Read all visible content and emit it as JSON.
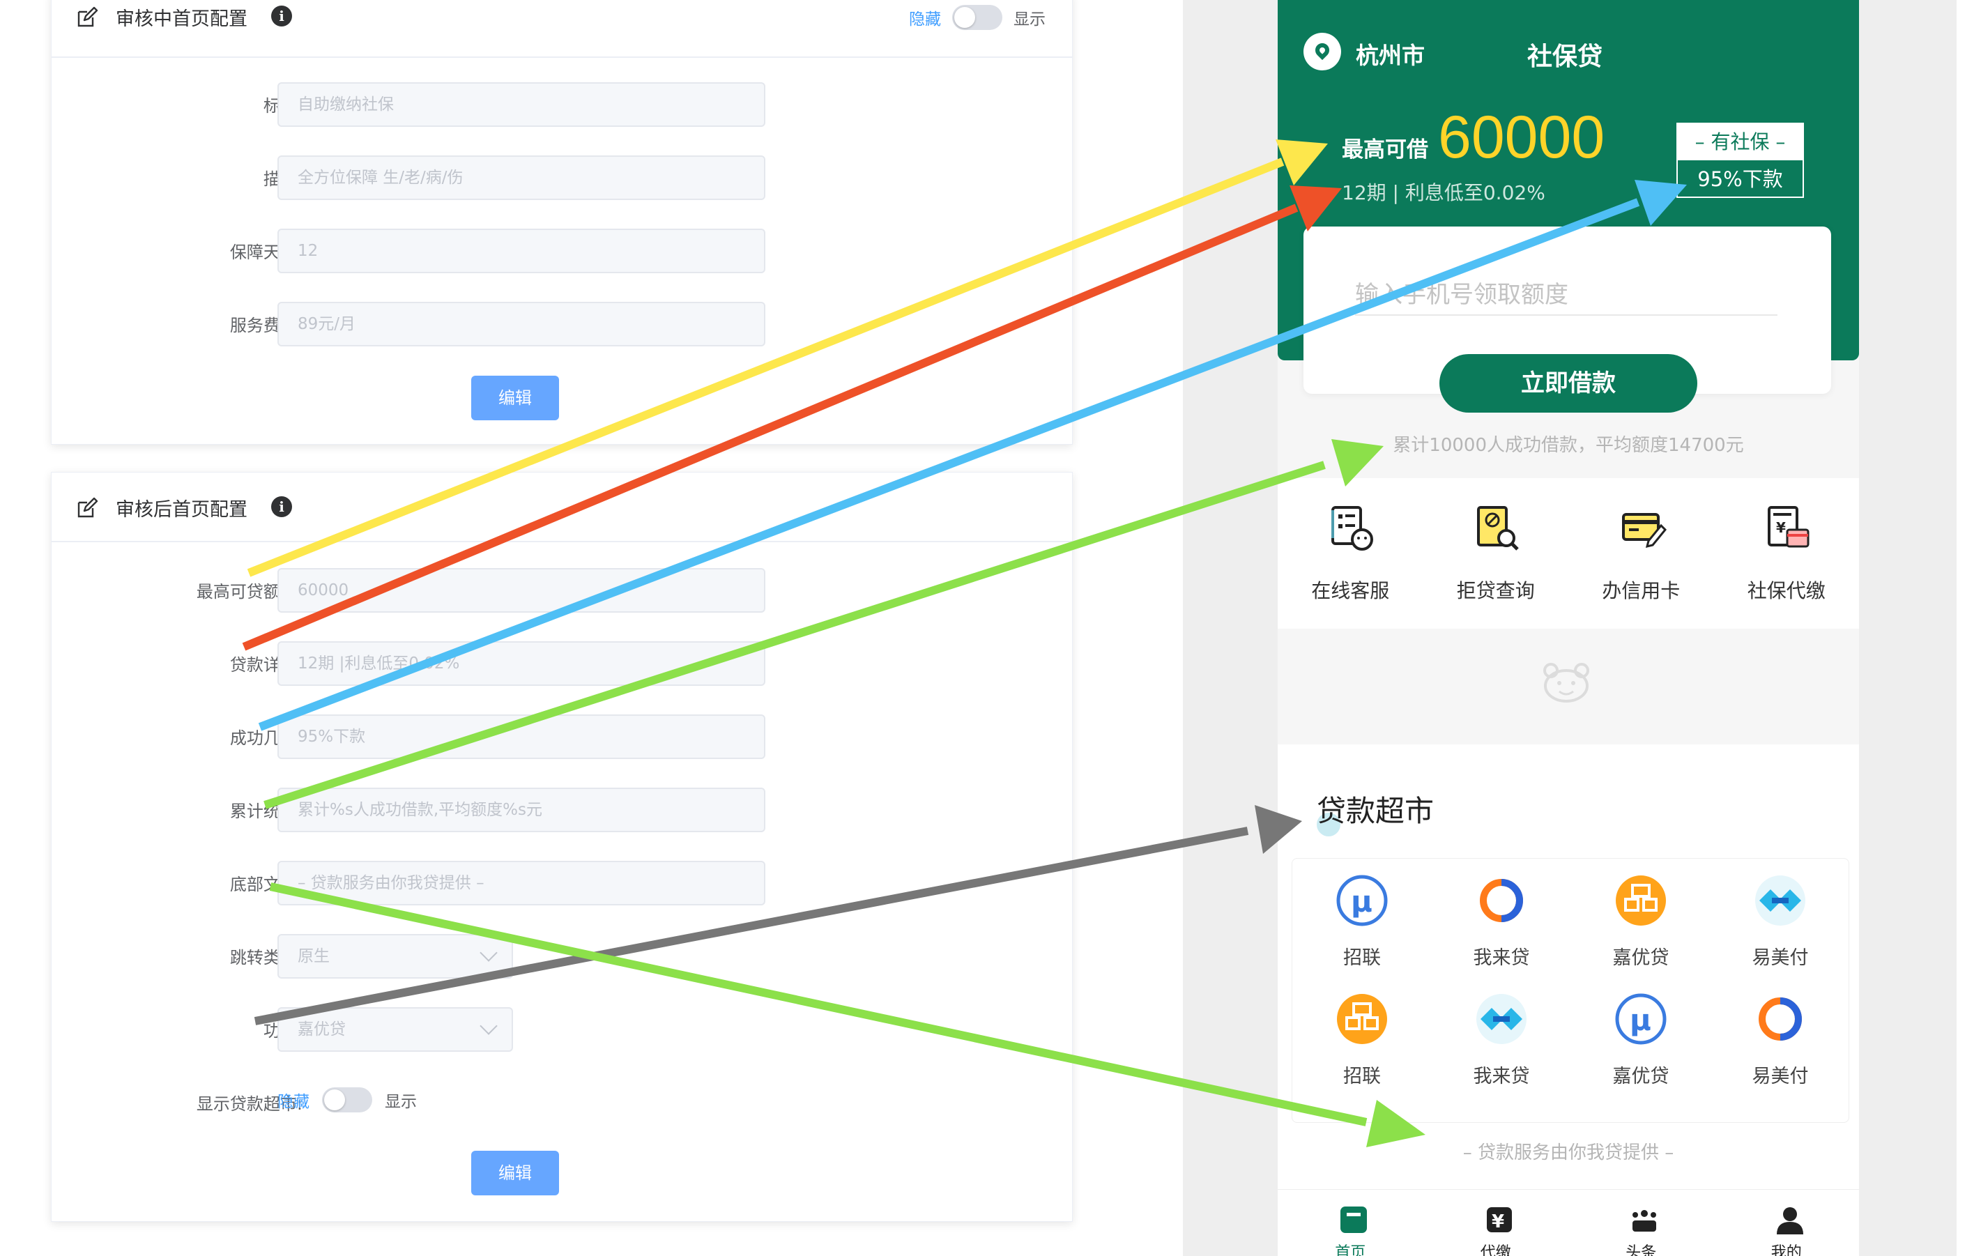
{
  "panel_review": {
    "title": "审核中首页配置",
    "toggle_off": "隐藏",
    "toggle_on": "显示",
    "fields": [
      {
        "label": "标题:",
        "placeholder": "自助缴纳社保"
      },
      {
        "label": "描述:",
        "placeholder": "全方位保障 生/老/病/伤"
      },
      {
        "label": "保障天数:",
        "placeholder": "12"
      },
      {
        "label": "服务费用:",
        "placeholder": "89元/月"
      }
    ],
    "edit_label": "编辑"
  },
  "panel_after": {
    "title": "审核后首页配置",
    "fields": [
      {
        "label": "最高可贷额度:",
        "placeholder": "60000"
      },
      {
        "label": "贷款详情:",
        "placeholder": "12期 |利息低至0.02%"
      },
      {
        "label": "成功几率:",
        "placeholder": "95%下款"
      },
      {
        "label": "累计统计:",
        "placeholder": "累计%s人成功借款,平均额度%s元"
      },
      {
        "label": "底部文案:",
        "placeholder": "– 贷款服务由你我贷提供 –"
      }
    ],
    "jump_type": {
      "label": "跳转类型:",
      "value": "原生"
    },
    "function": {
      "label": "功能:",
      "value": "嘉优贷"
    },
    "show_market": {
      "label": "显示贷款超市:",
      "off": "隐藏",
      "on": "显示"
    },
    "edit_label": "编辑"
  },
  "phone": {
    "city": "杭州市",
    "app_title": "社保贷",
    "max_label": "最高可借",
    "max_amount": "60000",
    "loan_detail": "12期 | 利息低至0.02%",
    "tag_top": "– 有社保 –",
    "tag_bottom": "95%下款",
    "phone_placeholder": "输入手机号领取额度",
    "cta": "立即借款",
    "stats": "累计10000人成功借款，平均额度14700元",
    "services": [
      {
        "label": "在线客服",
        "icon": "customer-service-icon"
      },
      {
        "label": "拒贷查询",
        "icon": "rejected-loan-query-icon"
      },
      {
        "label": "办信用卡",
        "icon": "credit-card-icon"
      },
      {
        "label": "社保代缴",
        "icon": "social-security-payment-icon"
      }
    ],
    "market_title": "贷款超市",
    "market": [
      {
        "label": "招联",
        "icon": "u-logo-icon"
      },
      {
        "label": "我来贷",
        "icon": "ring-logo-icon"
      },
      {
        "label": "嘉优贷",
        "icon": "orange-box-logo-icon"
      },
      {
        "label": "易美付",
        "icon": "diamond-logo-icon"
      },
      {
        "label": "招联",
        "icon": "orange-box-logo-icon"
      },
      {
        "label": "我来贷",
        "icon": "diamond-logo-icon"
      },
      {
        "label": "嘉优贷",
        "icon": "u-logo-icon"
      },
      {
        "label": "易美付",
        "icon": "ring-logo-icon"
      }
    ],
    "footer_note": "– 贷款服务由你我贷提供 –",
    "tabs": [
      {
        "label": "首页",
        "active": true
      },
      {
        "label": "代缴",
        "active": false
      },
      {
        "label": "头条",
        "active": false
      },
      {
        "label": "我的",
        "active": false
      }
    ]
  },
  "colors": {
    "brand_green": "#0b7a5a",
    "amount_yellow": "#ffd429",
    "primary_blue": "#409eff",
    "arrow_yellow": "#fde74c",
    "arrow_red": "#ee5128",
    "arrow_blue": "#4fbff5",
    "arrow_green": "#8ce04a",
    "arrow_gray": "#777777"
  }
}
